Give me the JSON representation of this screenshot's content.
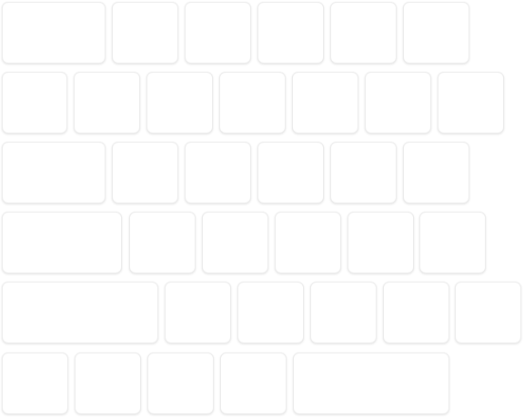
{
  "keyboard": {
    "rows": [
      {
        "keys": [
          {
            "label": ""
          },
          {
            "label": ""
          },
          {
            "label": ""
          },
          {
            "label": ""
          },
          {
            "label": ""
          },
          {
            "label": ""
          }
        ]
      },
      {
        "keys": [
          {
            "label": ""
          },
          {
            "label": ""
          },
          {
            "label": ""
          },
          {
            "label": ""
          },
          {
            "label": ""
          },
          {
            "label": ""
          },
          {
            "label": ""
          }
        ]
      },
      {
        "keys": [
          {
            "label": ""
          },
          {
            "label": ""
          },
          {
            "label": ""
          },
          {
            "label": ""
          },
          {
            "label": ""
          },
          {
            "label": ""
          }
        ]
      },
      {
        "keys": [
          {
            "label": ""
          },
          {
            "label": ""
          },
          {
            "label": ""
          },
          {
            "label": ""
          },
          {
            "label": ""
          },
          {
            "label": ""
          }
        ]
      },
      {
        "keys": [
          {
            "label": ""
          },
          {
            "label": ""
          },
          {
            "label": ""
          },
          {
            "label": ""
          },
          {
            "label": ""
          },
          {
            "label": ""
          }
        ]
      },
      {
        "keys": [
          {
            "label": ""
          },
          {
            "label": ""
          },
          {
            "label": ""
          },
          {
            "label": ""
          },
          {
            "label": ""
          }
        ]
      }
    ]
  }
}
